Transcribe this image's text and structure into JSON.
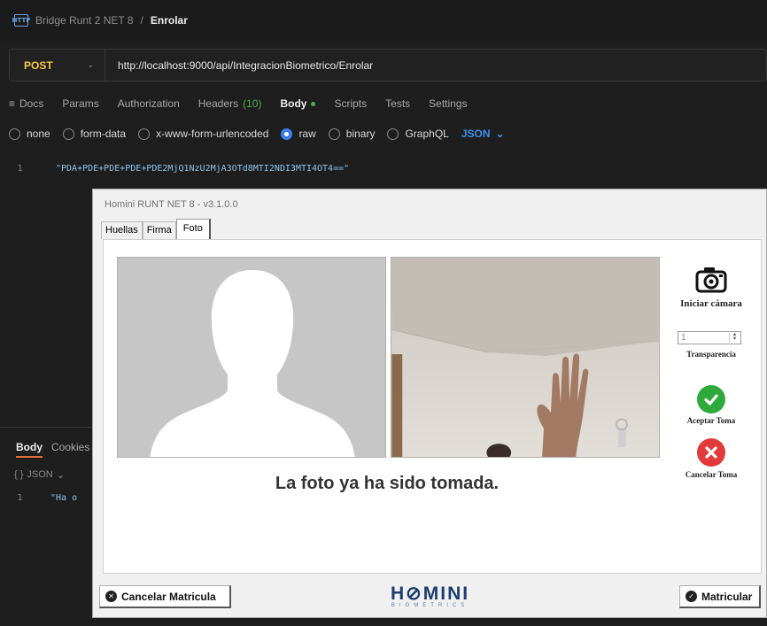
{
  "breadcrumb": {
    "parent": "Bridge Runt 2 NET 8",
    "separator": "/",
    "current": "Enrolar",
    "icon": "http-icon"
  },
  "request": {
    "method": "POST",
    "url": "http://localhost:9000/api/IntegracionBiometrico/Enrolar"
  },
  "tabs": [
    {
      "label": "Docs"
    },
    {
      "label": "Params"
    },
    {
      "label": "Authorization"
    },
    {
      "label": "Headers",
      "count": "(10)"
    },
    {
      "label": "Body"
    },
    {
      "label": "Scripts"
    },
    {
      "label": "Tests"
    },
    {
      "label": "Settings"
    }
  ],
  "body_options": {
    "none": "none",
    "form_data": "form-data",
    "urlencoded": "x-www-form-urlencoded",
    "raw": "raw",
    "binary": "binary",
    "graphql": "GraphQL",
    "format": "JSON",
    "selected": "raw"
  },
  "editor": {
    "line_no": "1",
    "content": "\"PDA+PDE+PDE+PDE+PDE2MjQ1NzU2MjA3OTd8MTI2NDI3MTI4OT4==\""
  },
  "response": {
    "tabs": [
      "Body",
      "Cookies"
    ],
    "format": "JSON",
    "line_no": "1",
    "content": "\"Ha o"
  },
  "dialog": {
    "title": "Homini RUNT NET 8 - v3.1.0.0",
    "tabs": [
      "Huellas",
      "Firma",
      "Foto"
    ],
    "active_tab": "Foto",
    "status_message": "La foto ya ha sido tomada.",
    "start_camera": "Iniciar cámara",
    "transparency_value": "1",
    "transparency_label": "Transparencia",
    "accept": "Aceptar Toma",
    "cancel": "Cancelar Toma",
    "cancel_enrollment": "Cancelar Matricula",
    "enroll": "Matricular",
    "logo_main": "H⊘MINI",
    "logo_sub": "BIOMETRICS"
  },
  "colors": {
    "method": "#f7c948",
    "accent": "#3d7ff0",
    "ok": "#2eaa3c",
    "cancel": "#e23a3a",
    "logo": "#1d3d6e"
  }
}
